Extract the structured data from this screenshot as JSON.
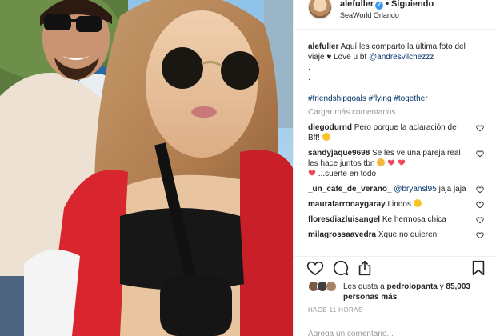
{
  "post": {
    "username": "alefuller",
    "follow_label": "Siguiendo",
    "location": "SeaWorld Orlando"
  },
  "caption": {
    "username": "alefuller",
    "text": "Aquí les comparto la última foto del viaje ♥ Love u bf",
    "mention": "@andresvilchezzz",
    "dot1": ".",
    "dot2": ".",
    "dot3": ".",
    "hashtags": "#friendshipgoals #flying #together"
  },
  "load_more_label": "Cargar más comentarios",
  "comments": [
    {
      "username": "diegodurnd",
      "text": "Pero porque la aclaración de Bff!"
    },
    {
      "username": "sandyjaque9698",
      "text": "Se les ve una pareja real les hace juntos tbn",
      "text2": "...suerte en todo"
    },
    {
      "username": "_un_cafe_de_verano_",
      "mention": "@bryansl95",
      "text": "jaja jaja"
    },
    {
      "username": "maurafarronaygaray",
      "text": "Lindos"
    },
    {
      "username": "floresdiazluisangel",
      "text": "Ke hermosa chica"
    },
    {
      "username": "milagrossaavedra",
      "text": "Xque no quieren"
    }
  ],
  "likes": {
    "prefix": "Les gusta a",
    "user": "pedrolopanta",
    "suffix": "y",
    "count": "85,003 personas más"
  },
  "timestamp": "HACE 11 HORAS",
  "add_comment_placeholder": "Agrega un comentario...",
  "colors": {
    "link": "#003569",
    "muted": "#999999",
    "verified": "#3897f0",
    "heart": "#ed4956",
    "text": "#262626"
  },
  "icons": [
    "verified-icon",
    "heart-outline-icon",
    "comment-icon",
    "share-icon",
    "bookmark-icon",
    "small-heart-icon"
  ]
}
